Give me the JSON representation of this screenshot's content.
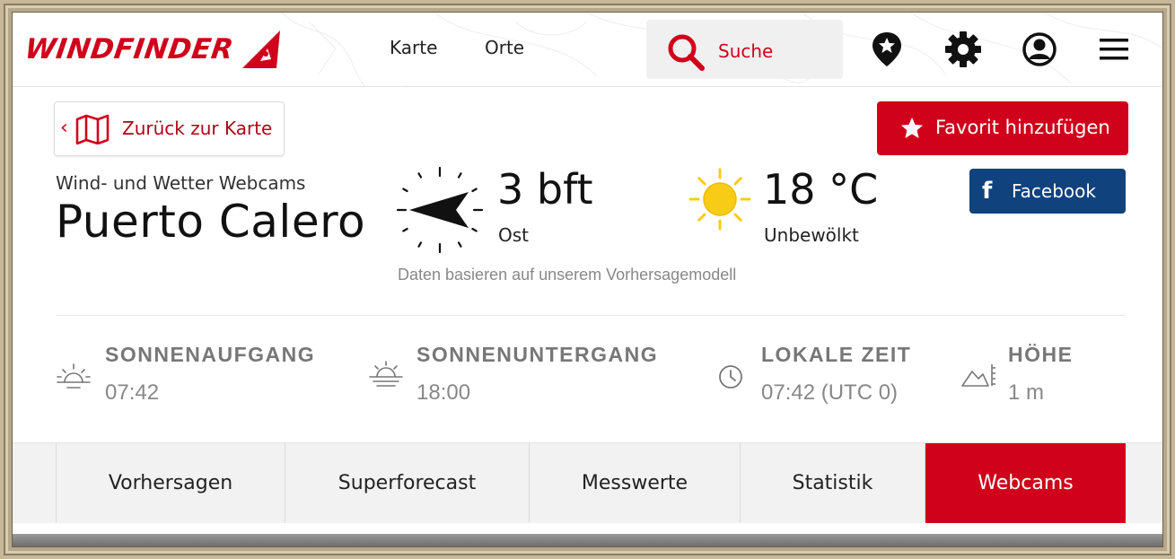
{
  "header": {
    "logo_text": "WINDFINDER",
    "nav": [
      "Karte",
      "Orte"
    ],
    "search_label": "Suche"
  },
  "actions": {
    "back_label": "Zurück zur Karte",
    "favorite_label": "Favorit hinzufügen",
    "facebook_icon": "f",
    "facebook_label": "Facebook"
  },
  "spot": {
    "subtitle": "Wind- und Wetter Webcams",
    "name": "Puerto Calero"
  },
  "weather": {
    "wind_value": "3 bft",
    "wind_direction": "Ost",
    "temperature": "18 °C",
    "condition": "Unbewölkt",
    "note": "Daten basieren auf unserem Vorhersagemodell"
  },
  "info": [
    {
      "label": "SONNENAUFGANG",
      "value": "07:42",
      "icon": "sunrise-icon"
    },
    {
      "label": "SONNENUNTERGANG",
      "value": "18:00",
      "icon": "sunset-icon"
    },
    {
      "label": "LOKALE ZEIT",
      "value": "07:42 (UTC 0)",
      "icon": "clock-icon"
    },
    {
      "label": "HÖHE",
      "value": "1 m",
      "icon": "elevation-icon"
    }
  ],
  "tabs": [
    "Vorhersagen",
    "Superforecast",
    "Messwerte",
    "Statistik",
    "Webcams"
  ],
  "active_tab": "Webcams",
  "colors": {
    "brand_red": "#d0021b",
    "facebook_blue": "#10427e",
    "sun_yellow": "#f8cc16"
  }
}
